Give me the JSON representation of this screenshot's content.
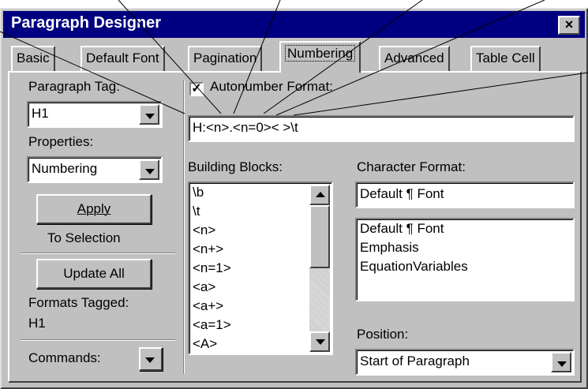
{
  "window": {
    "title": "Paragraph Designer",
    "close_label": "×"
  },
  "tabs": [
    "Basic",
    "Default Font",
    "Pagination",
    "Numbering",
    "Advanced",
    "Table Cell"
  ],
  "active_tab": "Numbering",
  "left": {
    "paragraph_tag_label": "Paragraph Tag:",
    "paragraph_tag_value": "H1",
    "properties_label": "Properties:",
    "properties_value": "Numbering",
    "apply_button": "Apply",
    "to_selection": "To Selection",
    "update_all_button": "Update All",
    "formats_tagged_label": "Formats Tagged:",
    "formats_tagged_value": "H1",
    "commands_label": "Commands:"
  },
  "autonumber": {
    "checked": true,
    "label": "Autonumber Format:",
    "format_value": "H:<n>.<n=0>< >\\t"
  },
  "building_blocks": {
    "label": "Building Blocks:",
    "items": [
      "\\b",
      "\\t",
      "<n>",
      "<n+>",
      "<n=1>",
      "<a>",
      "<a+>",
      "<a=1>",
      "<A>"
    ]
  },
  "character_format": {
    "label": "Character Format:",
    "value": "Default ¶ Font",
    "items": [
      "Default ¶ Font",
      "Emphasis",
      "EquationVariables"
    ]
  },
  "position": {
    "label": "Position:",
    "value": "Start of Paragraph"
  }
}
